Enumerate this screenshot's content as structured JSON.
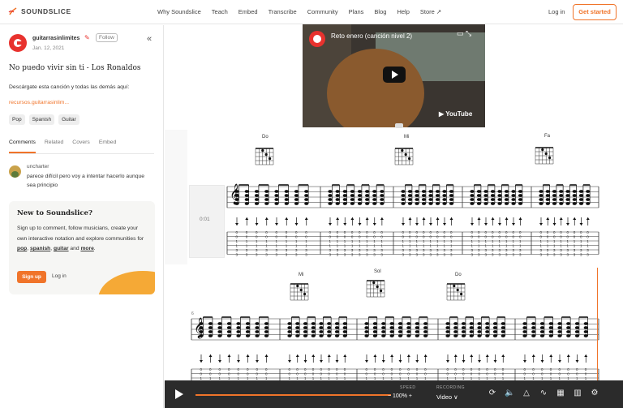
{
  "header": {
    "brand": "SOUNDSLICE",
    "nav": [
      "Why Soundslice",
      "Teach",
      "Embed",
      "Transcribe",
      "Community",
      "Plans",
      "Blog",
      "Help",
      "Store ↗"
    ],
    "login": "Log in",
    "get_started": "Get started"
  },
  "sidebar": {
    "author": "guitarrasinlimites",
    "follow": "Follow",
    "date": "Jan. 12, 2021",
    "collapse_glyph": "«",
    "title": "No puedo vivir sin ti - Los Ronaldos",
    "description": "Descárgate esta canción y todas las demás aquí:",
    "link": "recursos.guitarrasinlim...",
    "tags": [
      "Pop",
      "Spanish",
      "Guitar"
    ],
    "tabs": [
      "Comments",
      "Related",
      "Covers",
      "Embed"
    ],
    "comment": {
      "user": "uncharter",
      "text": "parece difícil pero voy a intentar hacerlo aunque sea principio"
    },
    "new_box": {
      "heading": "New to Soundslice?",
      "text_pre": "Sign up to comment, follow musicians, create your own interactive notation and explore communities for ",
      "pop": "pop",
      "comma": ", ",
      "spanish": "spanish",
      "comma2": ",",
      "guitar": "guitar",
      "and": " and ",
      "more": "more",
      "period": ".",
      "signup": "Sign up",
      "login": "Log in"
    }
  },
  "video": {
    "title": "Reto enero (canción nivel 2)",
    "youtube": "YouTube"
  },
  "notation": {
    "time_marker": "0:01",
    "chords_row1": [
      "Do",
      "Mi",
      "Fa"
    ],
    "chords_row2": [
      "Mi",
      "Sol",
      "Do"
    ],
    "measure_number": "6"
  },
  "player": {
    "progress": 1.0,
    "speed_label": "SPEED",
    "speed_value": "− 100% +",
    "recording_label": "RECORDING",
    "recording_value": "Video ∨"
  },
  "colors": {
    "accent": "#f0742a",
    "player_bg": "#2b2b2b"
  }
}
